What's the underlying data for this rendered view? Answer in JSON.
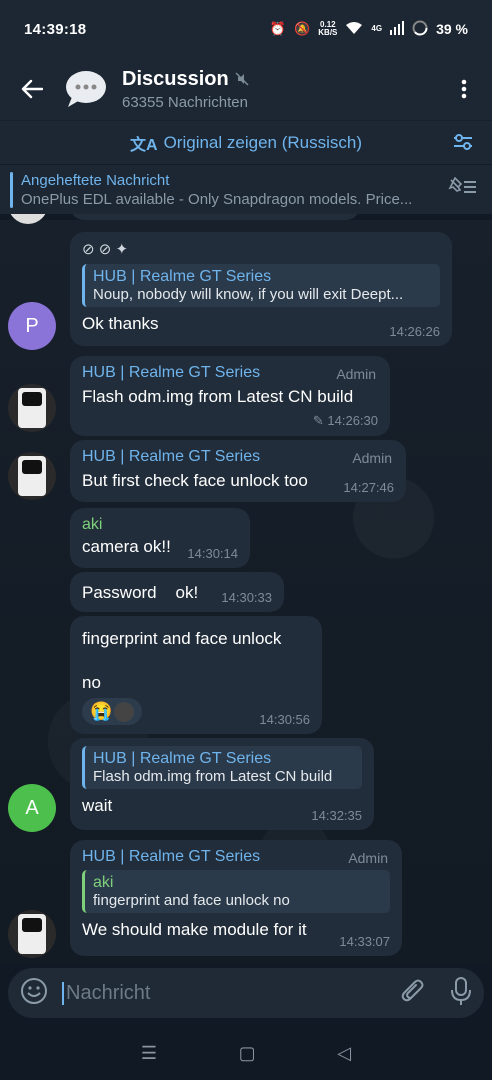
{
  "status": {
    "time": "14:39:18",
    "net_speed": "0.12",
    "net_unit": "KB/S",
    "network": "4G",
    "battery": "39 %"
  },
  "header": {
    "title": "Discussion",
    "subtitle": "63355 Nachrichten"
  },
  "translate": {
    "label": "Original zeigen (Russisch)"
  },
  "pinned": {
    "title": "Angeheftete Nachricht",
    "text": "OnePlus EDL available - Only Snapdragon models. Price..."
  },
  "messages": [
    {
      "reply_name": "HUB | Realme GT Series",
      "reply_text": "Noup, nobody will know, if you will exit Deept...",
      "text": "Ok thanks",
      "time": "14:26:26",
      "avatar": "P"
    },
    {
      "name": "HUB | Realme GT Series",
      "role": "Admin",
      "text": "Flash odm.img from Latest CN build",
      "time": "14:26:30"
    },
    {
      "name": "HUB | Realme GT Series",
      "role": "Admin",
      "text": "But first check face unlock too",
      "time": "14:27:46"
    },
    {
      "name": "aki",
      "text": "camera ok!!",
      "time": "14:30:14"
    },
    {
      "text": "Password    ok!",
      "time": "14:30:33"
    },
    {
      "text_line1": "fingerprint and face unlock",
      "text_line2": "no",
      "time": "14:30:56"
    },
    {
      "reply_name": "HUB | Realme GT Series",
      "reply_text": "Flash odm.img from Latest CN build",
      "text": "wait",
      "time": "14:32:35",
      "avatar": "A"
    },
    {
      "name": "HUB | Realme GT Series",
      "role": "Admin",
      "reply_name": "aki",
      "reply_text": "fingerprint and face unlock  no",
      "text": "We should make module for it",
      "time": "14:33:07"
    }
  ],
  "input": {
    "placeholder": "Nachricht"
  },
  "colors": {
    "accent": "#6fb4ec",
    "bubble": "#212d3a",
    "header": "#1d2733",
    "green_name": "#7fd07a",
    "avatar_p": "#8a74d8",
    "avatar_a": "#4cbf4c"
  }
}
